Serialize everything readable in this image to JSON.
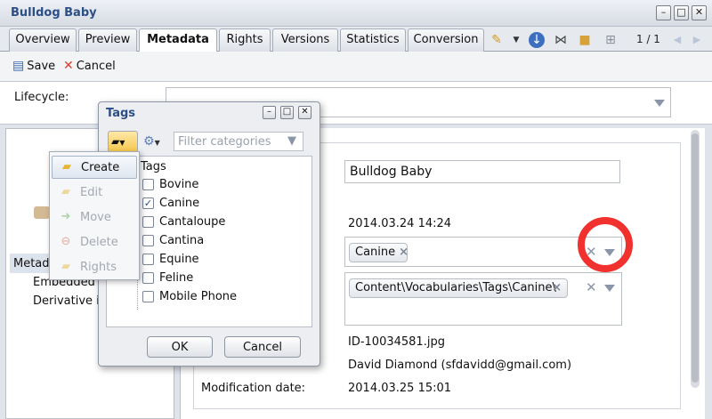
{
  "window": {
    "title": "Bulldog Baby"
  },
  "tabs": [
    {
      "label": "Overview"
    },
    {
      "label": "Preview"
    },
    {
      "label": "Metadata"
    },
    {
      "label": "Rights"
    },
    {
      "label": "Versions"
    },
    {
      "label": "Statistics"
    },
    {
      "label": "Conversion"
    }
  ],
  "pager": {
    "text": "1 / 1"
  },
  "toolbar": {
    "save_label": "Save",
    "cancel_label": "Cancel"
  },
  "lifecycle": {
    "label": "Lifecycle:"
  },
  "left_panel": {
    "items": [
      "Metadata",
      "Embedded metadata",
      "Derivative info"
    ]
  },
  "form": {
    "title_value": "Bulldog Baby",
    "date_value": "2014.03.24 14:24",
    "tag_chip": "Canine",
    "path_chip": "Content\\Vocabularies\\Tags\\Canine\\",
    "filename": "ID-10034581.jpg",
    "modified_by": "David Diamond (sfdavidd@gmail.com)",
    "modification_date_label": "Modification date:",
    "modification_date_value": "2014.03.25 15:01"
  },
  "tags_dialog": {
    "title": "Tags",
    "filter_placeholder": "Filter categories",
    "root": "Tags",
    "items": [
      {
        "label": "Bovine",
        "checked": false
      },
      {
        "label": "Canine",
        "checked": true
      },
      {
        "label": "Cantaloupe",
        "checked": false
      },
      {
        "label": "Cantina",
        "checked": false
      },
      {
        "label": "Equine",
        "checked": false
      },
      {
        "label": "Feline",
        "checked": false
      },
      {
        "label": "Mobile Phone",
        "checked": false
      }
    ],
    "ok_label": "OK",
    "cancel_label": "Cancel"
  },
  "context_menu": {
    "items": [
      {
        "label": "Create",
        "enabled": true
      },
      {
        "label": "Edit",
        "enabled": false
      },
      {
        "label": "Move",
        "enabled": false
      },
      {
        "label": "Delete",
        "enabled": false
      },
      {
        "label": "Rights",
        "enabled": false
      }
    ]
  },
  "colors": {
    "title_blue": "#2c4f86",
    "highlight_red": "#f0312e"
  }
}
